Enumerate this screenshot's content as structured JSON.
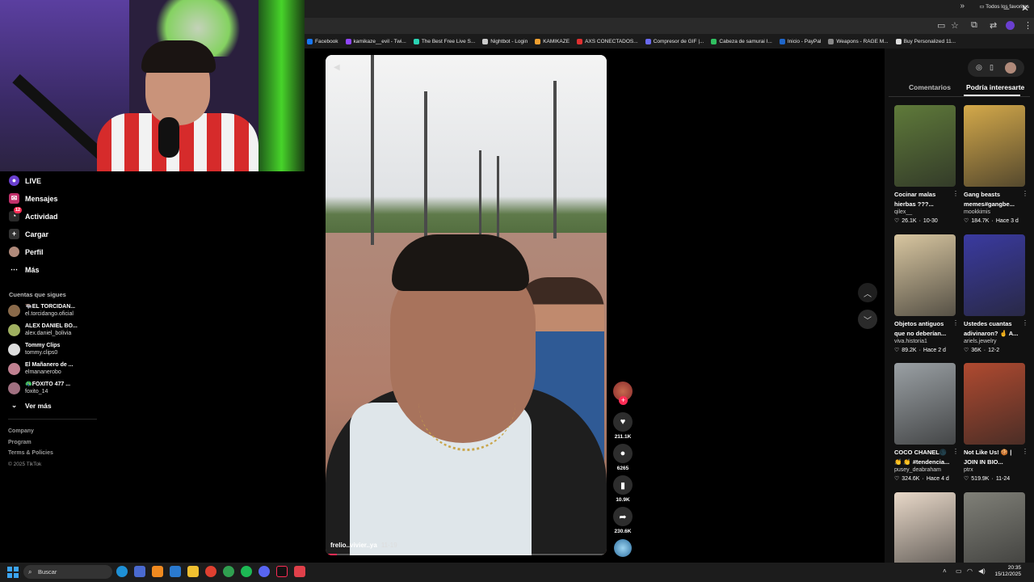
{
  "browser": {
    "bookmarks": [
      {
        "label": "Facebook",
        "color": "#1877f2"
      },
      {
        "label": "kamikaze__evil - Twi...",
        "color": "#9146ff"
      },
      {
        "label": "The Best Free Live S...",
        "color": "#2ad4b4"
      },
      {
        "label": "Nightbot - Login",
        "color": "#cccccc"
      },
      {
        "label": "KAMIKAZE",
        "color": "#f0a030"
      },
      {
        "label": "AXS CONECTADOS...",
        "color": "#e03030"
      },
      {
        "label": "Compresor de GIF |...",
        "color": "#6a6af0"
      },
      {
        "label": "Cabeza de samurai I...",
        "color": "#30c060"
      },
      {
        "label": "Inicio - PayPal",
        "color": "#1f66c9"
      },
      {
        "label": "Weapons - RAGE M...",
        "color": "#888888"
      },
      {
        "label": "Buy Personalized 11...",
        "color": "#dddddd"
      }
    ],
    "favorites_label": "Todos los favoritos"
  },
  "sidebar": {
    "items": [
      {
        "label": "LIVE",
        "icon": "live-icon"
      },
      {
        "label": "Mensajes",
        "icon": "messages-icon"
      },
      {
        "label": "Actividad",
        "icon": "activity-icon",
        "badge": "12"
      },
      {
        "label": "Cargar",
        "icon": "upload-icon"
      },
      {
        "label": "Perfil",
        "icon": "profile-icon"
      },
      {
        "label": "Más",
        "icon": "more-icon"
      }
    ],
    "following_title": "Cuentas que sigues",
    "following": [
      {
        "name": "🐃EL TORCIDAN...",
        "handle": "el.torcidango.oficial",
        "color": "#8a6a4a"
      },
      {
        "name": "ALEX DANIEL BO...",
        "handle": "alex.daniel_bolivia",
        "color": "#a0b060"
      },
      {
        "name": "Tommy Clips",
        "handle": "tommy.clips0",
        "color": "#dddddd"
      },
      {
        "name": "El Mañanero de ...",
        "handle": "elmananerobo",
        "color": "#c08090"
      },
      {
        "name": "🦚FOXITO 477 ...",
        "handle": "foxito_14",
        "color": "#a07080"
      }
    ],
    "see_more": "Ver más",
    "footer": [
      "Company",
      "Program",
      "Terms & Policies",
      "© 2025 TikTok"
    ]
  },
  "video": {
    "username": "frelio..vivier..ya",
    "date": "11-19",
    "progress": 0.04
  },
  "actions": {
    "likes": "211.1K",
    "comments": "6265",
    "saves": "10.9K",
    "shares": "230.6K"
  },
  "right_panel": {
    "tabs": [
      "Comentarios",
      "Podría interesarte"
    ],
    "active_tab": 1,
    "cards": [
      {
        "title": "Cocinar malas hierbas ???...",
        "author": "qilex__",
        "likes": "26.1K",
        "date": "10-30",
        "bg": "#5f7a3a"
      },
      {
        "title": "Gang beasts memes#gangbe...",
        "author": "mookkimis",
        "likes": "184.7K",
        "date": "Hace 3 d",
        "bg": "#d4a94a"
      },
      {
        "title": "Objetos antiguos que no deberían...",
        "author": "viva.historia1",
        "likes": "89.2K",
        "date": "Hace 2 d",
        "bg": "#d8c6a0"
      },
      {
        "title": "Ustedes cuantas adivinaron? 🤞 A...",
        "author": "ariels.jewelry",
        "likes": "36K",
        "date": "12-2",
        "bg": "#3a3aa0"
      },
      {
        "title": "COCO CHANEL🌑 👏 👏 #tendencia...",
        "author": "pusey_deabraham",
        "likes": "324.6K",
        "date": "Hace 4 d",
        "bg": "#9aa0a4"
      },
      {
        "title": "Not Like Us! 🍪 | JOIN IN BIO...",
        "author": "ptrx",
        "likes": "519.9K",
        "date": "11-24",
        "bg": "#b04a30"
      },
      {
        "title": "",
        "author": "",
        "likes": "",
        "date": "",
        "bg": "#e8d8c8"
      },
      {
        "title": "",
        "author": "",
        "likes": "",
        "date": "",
        "bg": "#808078"
      }
    ]
  },
  "taskbar": {
    "search_placeholder": "Buscar",
    "time": "20:35",
    "date": "15/12/2025"
  },
  "colors": {
    "accent": "#fe2c55",
    "panel": "#111111"
  }
}
